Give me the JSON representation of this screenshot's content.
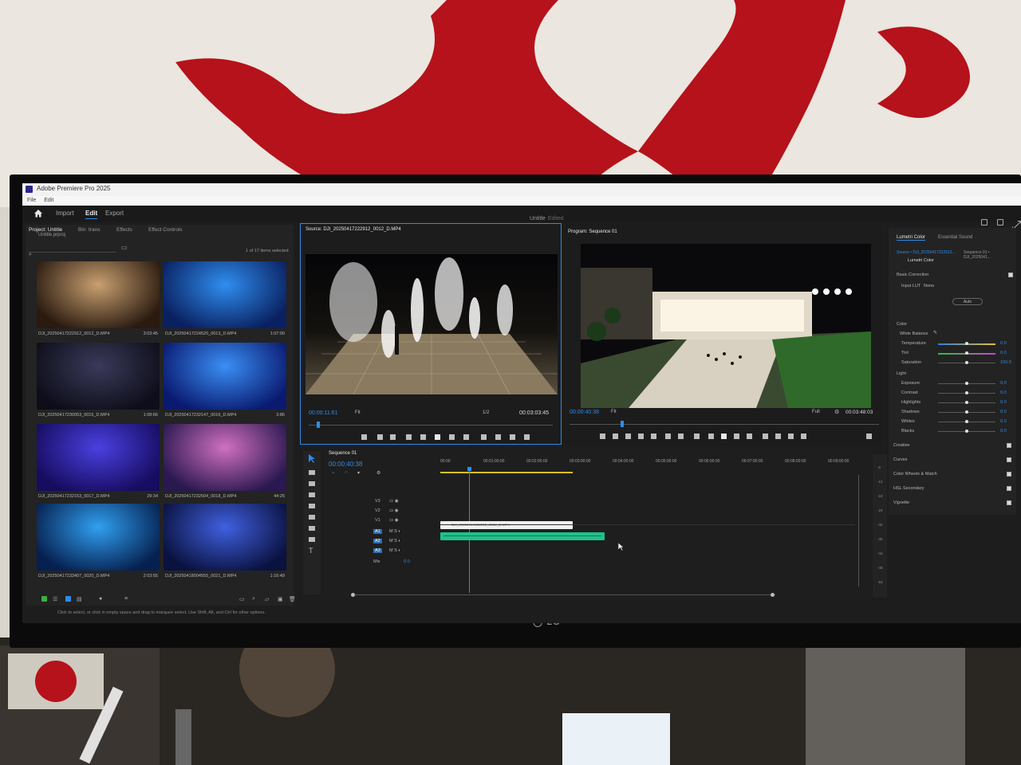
{
  "window": {
    "app_title": "Adobe Premiere Pro 2025",
    "menu": [
      "File",
      "Edit"
    ]
  },
  "header": {
    "tabs": [
      {
        "label": "Import"
      },
      {
        "label": "Edit"
      },
      {
        "label": "Export"
      }
    ],
    "doc_title": "Untitle",
    "doc_status": "Edited"
  },
  "project": {
    "tabs": [
      "Project: Untitle",
      "Bin: trans",
      "Effects",
      "Effect Controls"
    ],
    "file": "Untitle.prproj",
    "count": "1 of 17 items selected",
    "clips": [
      {
        "name": "DJI_20250417222912_0012_D.MP4",
        "duration": "3:03:45",
        "color1": "#c8a070",
        "color2": "#2a1a10"
      },
      {
        "name": "DJI_20250417224520_0013_D.MP4",
        "duration": "1:07:00",
        "color1": "#2f8ef0",
        "color2": "#0a2060"
      },
      {
        "name": "DJI_20250417230053_0015_D.MP4",
        "duration": "1:08:66",
        "color1": "#3a3a5a",
        "color2": "#0e0e1a"
      },
      {
        "name": "DJI_20250417232147_0016_D.MP4",
        "duration": "3:86",
        "color1": "#3a8ff5",
        "color2": "#0a1a70"
      },
      {
        "name": "DJI_20250417232153_0017_D.MP4",
        "duration": "29:34",
        "color1": "#4a40e0",
        "color2": "#160c60"
      },
      {
        "name": "DJI_20250417232504_0018_D.MP4",
        "duration": "44:25",
        "color1": "#d070c0",
        "color2": "#2a1850"
      },
      {
        "name": "DJI_20250417233407_0020_D.MP4",
        "duration": "2:03:55",
        "color1": "#30a0f0",
        "color2": "#062050"
      },
      {
        "name": "DJI_20250418004555_0021_D.MP4",
        "duration": "1:16:49",
        "color1": "#4060e0",
        "color2": "#0a1240"
      }
    ]
  },
  "source": {
    "title": "Source: DJI_20250417222912_0012_D.MP4",
    "timecode": "00:00:11:61",
    "fit": "Fit",
    "resolution": "1/2",
    "duration": "00:03:03:45"
  },
  "program": {
    "title": "Program: Sequence 01",
    "timecode": "00:00:40:38",
    "fit": "Fit",
    "quality": "Full",
    "duration": "00:03:48:03"
  },
  "timeline": {
    "tab": "Sequence 01",
    "timecode": "00:00:40:38",
    "ruler": [
      "00:00",
      "00:01:00:00",
      "00:02:00:00",
      "00:03:00:00",
      "00:04:00:00",
      "00:05:00:00",
      "00:06:00:00",
      "00:07:00:00",
      "00:08:00:00",
      "00:09:00:00"
    ],
    "video_tracks": [
      "V3",
      "V2",
      "V1"
    ],
    "audio_tracks": [
      "A1",
      "A2",
      "A3"
    ],
    "mix_label": "Mix",
    "mix_value": "0.0",
    "clip_label": "DJI_20250417222912_0012_D.MP4",
    "meter_ticks": [
      "-6",
      "-12",
      "-18",
      "-24",
      "-30",
      "-36",
      "-42",
      "-48",
      "-54"
    ]
  },
  "lumetri": {
    "tabs": [
      "Lumetri Color",
      "Essential Sound"
    ],
    "source": "Source • DJI_20250417222912...",
    "sequence": "Sequence 01 • DJI_2025041...",
    "effect": "Lumetri Color",
    "basic_correction": "Basic Correction",
    "input_lut_label": "Input LUT",
    "input_lut_value": "None",
    "auto_label": "Auto",
    "color_section": "Color",
    "white_balance": "White Balance",
    "color_rows": [
      {
        "label": "Temperature",
        "value": "0.0"
      },
      {
        "label": "Tint",
        "value": "0.0"
      },
      {
        "label": "Saturation",
        "value": "100.0"
      }
    ],
    "light_section": "Light",
    "light_rows": [
      {
        "label": "Exposure",
        "value": "0.0"
      },
      {
        "label": "Contrast",
        "value": "0.0"
      },
      {
        "label": "Highlights",
        "value": "0.0"
      },
      {
        "label": "Shadows",
        "value": "0.0"
      },
      {
        "label": "Whites",
        "value": "0.0"
      },
      {
        "label": "Blacks",
        "value": "0.0"
      }
    ],
    "sections": [
      "Creative",
      "Curves",
      "Color Wheels & Match",
      "HSL Secondary",
      "Vignette"
    ]
  },
  "status": {
    "text": "Click to select, or click in empty space and drag to marquee select. Use Shift, Alt, and Ctrl for other options."
  },
  "colors": {
    "accent": "#2d8ceb",
    "audio_clip": "#1fc28a",
    "wall_paint": "#b5121b"
  }
}
